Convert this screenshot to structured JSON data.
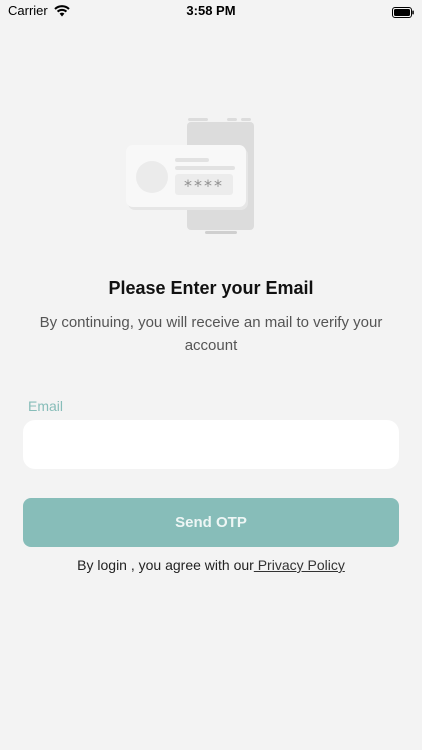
{
  "status_bar": {
    "carrier": "Carrier",
    "time": "3:58 PM",
    "icons": [
      "wifi-icon",
      "battery-icon"
    ]
  },
  "illustration": {
    "icon": "otp-illustration",
    "code_text": "****"
  },
  "header": {
    "title": "Please Enter your Email",
    "subtitle": "By continuing, you will receive an mail to verify your account"
  },
  "form": {
    "email_label": "Email",
    "email_value": "",
    "email_placeholder": "",
    "send_button_label": "Send OTP"
  },
  "footer": {
    "agree_text": "By login , you agree with our",
    "privacy_link": " Privacy Policy"
  },
  "colors": {
    "accent": "#87bdb9",
    "background": "#f3f3f3",
    "input_bg": "#ffffff"
  }
}
